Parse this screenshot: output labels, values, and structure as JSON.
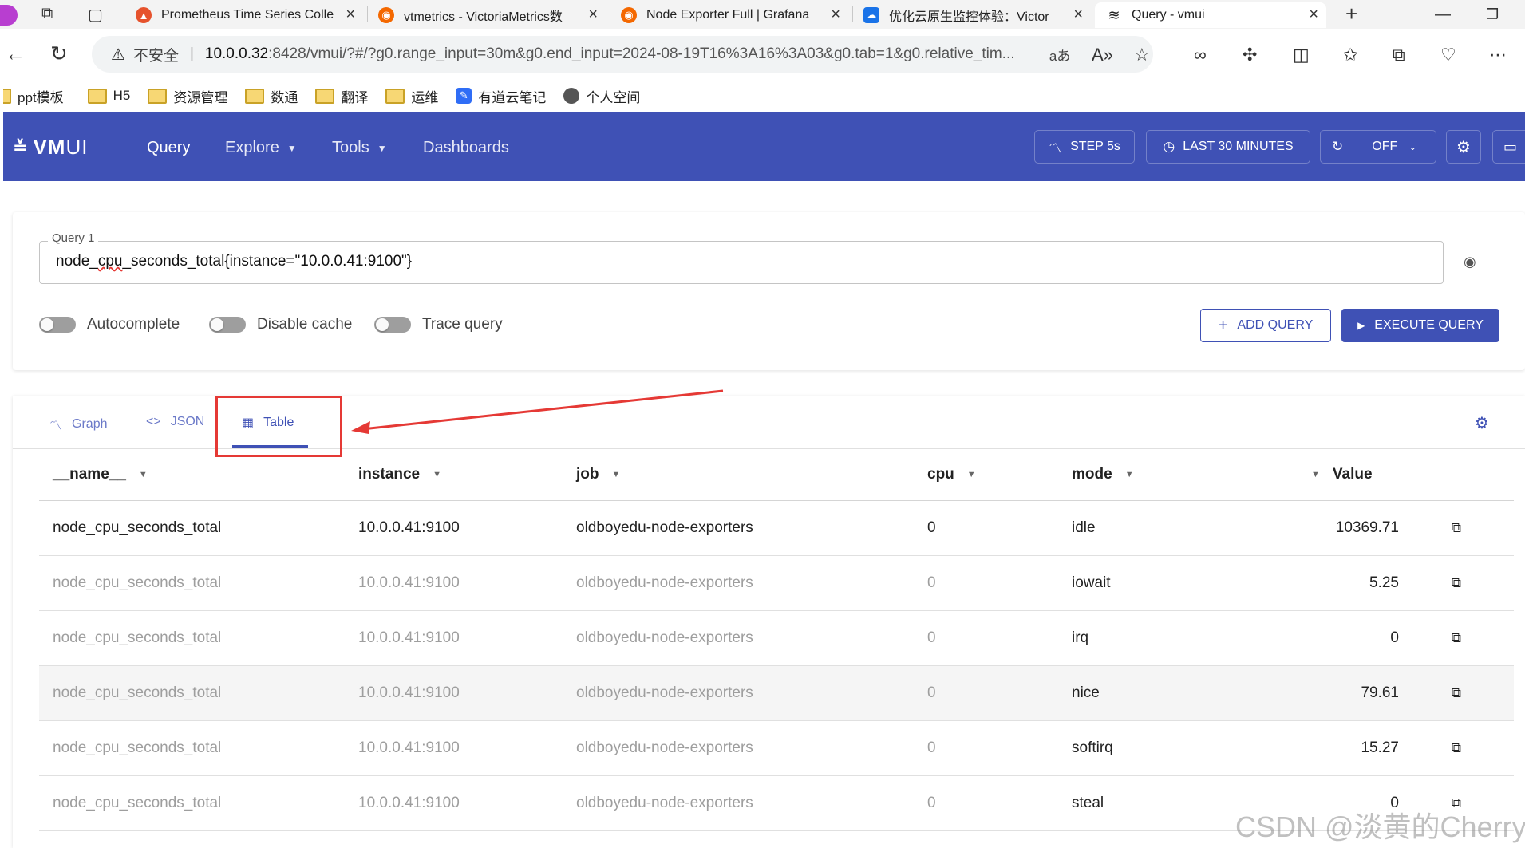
{
  "browser": {
    "tabs": [
      {
        "title": "Prometheus Time Series Colle",
        "favicon": "prometheus-icon",
        "color": "#e6522c",
        "active": false
      },
      {
        "title": "vtmetrics - VictoriaMetrics数",
        "favicon": "grafana-icon",
        "color": "#f46800",
        "active": false
      },
      {
        "title": "Node Exporter Full | Grafana",
        "favicon": "grafana-icon",
        "color": "#f46800",
        "active": false
      },
      {
        "title": "优化云原生监控体验：Victor",
        "favicon": "cloud-icon",
        "color": "#1a73e8",
        "active": false
      },
      {
        "title": "Query - vmui",
        "favicon": "vmui-icon",
        "color": "#222222",
        "active": true
      }
    ],
    "security_label": "不安全",
    "url_host": "10.0.0.32",
    "url_rest": ":8428/vmui/?#/?g0.range_input=30m&g0.end_input=2024-08-19T16%3A16%3A03&g0.tab=1&g0.relative_tim...",
    "bookmarks": [
      {
        "label": "ppt模板",
        "type": "folder"
      },
      {
        "label": "H5",
        "type": "folder"
      },
      {
        "label": "资源管理",
        "type": "folder"
      },
      {
        "label": "数通",
        "type": "folder"
      },
      {
        "label": "翻译",
        "type": "folder"
      },
      {
        "label": "运维",
        "type": "folder"
      },
      {
        "label": "有道云笔记",
        "type": "app"
      },
      {
        "label": "个人空间",
        "type": "globe"
      }
    ]
  },
  "app": {
    "logo_vm": "VM",
    "logo_ui": "UI",
    "nav": {
      "query": "Query",
      "explore": "Explore",
      "tools": "Tools",
      "dashboards": "Dashboards"
    },
    "step_label": "STEP 5s",
    "range_label": "LAST 30 MINUTES",
    "refresh_label": "OFF",
    "accent": "#3f51b5"
  },
  "query": {
    "label": "Query 1",
    "metric": "node_",
    "metric_squiggle": "cpu",
    "rest": "_seconds_total{instance=\"10.0.0.41:9100\"}",
    "toggles": {
      "autocomplete": "Autocomplete",
      "disable_cache": "Disable cache",
      "trace": "Trace query"
    },
    "add_label": "ADD QUERY",
    "execute_label": "EXECUTE QUERY"
  },
  "results": {
    "tabs": {
      "graph": "Graph",
      "json": "JSON",
      "table": "Table"
    },
    "columns": [
      "__name__",
      "instance",
      "job",
      "cpu",
      "mode",
      "Value"
    ],
    "rows": [
      {
        "name": "node_cpu_seconds_total",
        "instance": "10.0.0.41:9100",
        "job": "oldboyedu-node-exporters",
        "cpu": "0",
        "mode": "idle",
        "value": "10369.71"
      },
      {
        "name": "node_cpu_seconds_total",
        "instance": "10.0.0.41:9100",
        "job": "oldboyedu-node-exporters",
        "cpu": "0",
        "mode": "iowait",
        "value": "5.25"
      },
      {
        "name": "node_cpu_seconds_total",
        "instance": "10.0.0.41:9100",
        "job": "oldboyedu-node-exporters",
        "cpu": "0",
        "mode": "irq",
        "value": "0"
      },
      {
        "name": "node_cpu_seconds_total",
        "instance": "10.0.0.41:9100",
        "job": "oldboyedu-node-exporters",
        "cpu": "0",
        "mode": "nice",
        "value": "79.61"
      },
      {
        "name": "node_cpu_seconds_total",
        "instance": "10.0.0.41:9100",
        "job": "oldboyedu-node-exporters",
        "cpu": "0",
        "mode": "softirq",
        "value": "15.27"
      },
      {
        "name": "node_cpu_seconds_total",
        "instance": "10.0.0.41:9100",
        "job": "oldboyedu-node-exporters",
        "cpu": "0",
        "mode": "steal",
        "value": "0"
      }
    ]
  },
  "watermark": "CSDN @淡黄的Cherry"
}
